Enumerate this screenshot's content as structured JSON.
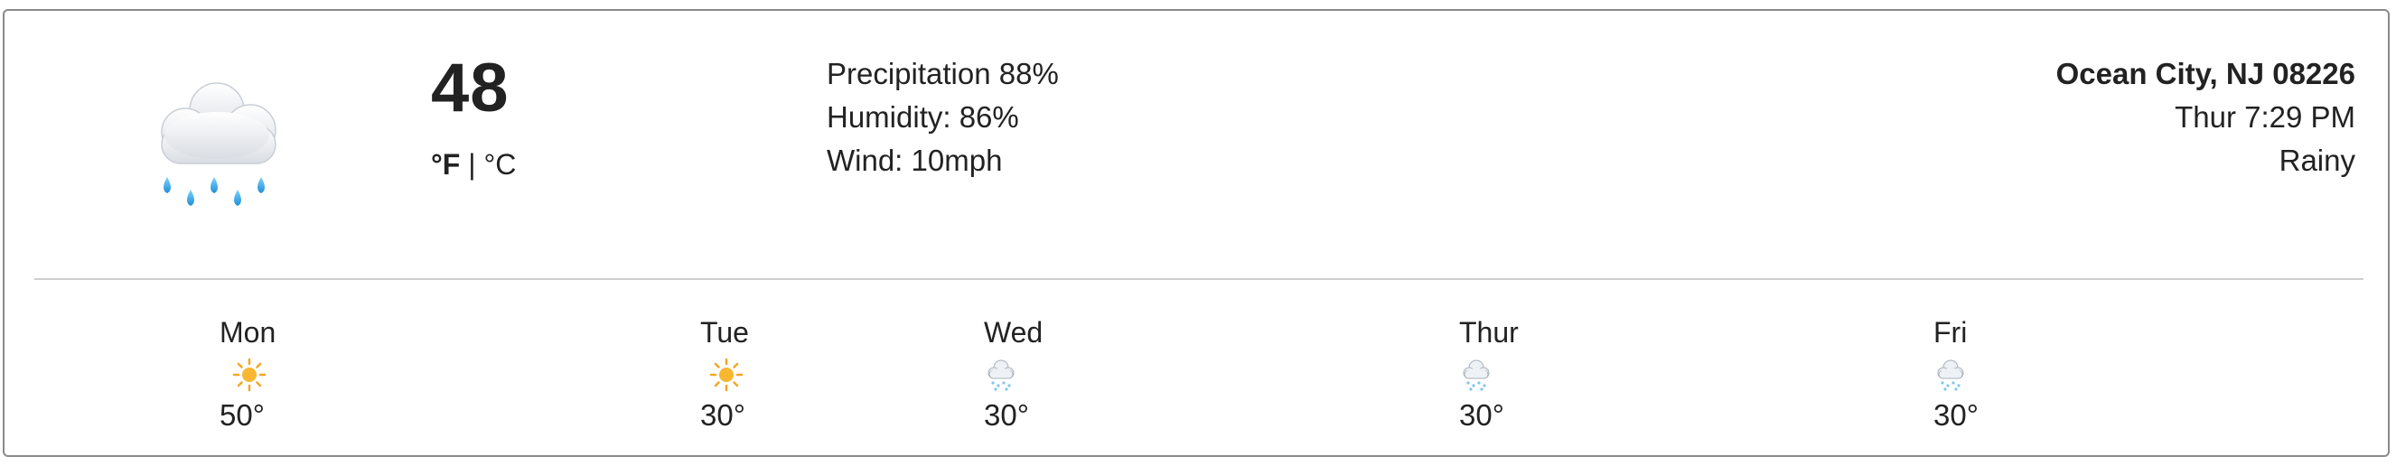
{
  "current": {
    "temperature": "48",
    "unit_f": "°F",
    "unit_separator": "|",
    "unit_c": "°C",
    "icon": "rain-cloud-icon",
    "precipitation": "Precipitation 88%",
    "humidity": "Humidity: 86%",
    "wind": "Wind: 10mph"
  },
  "location": {
    "city": "Ocean City, NJ 08226",
    "datetime": "Thur 7:29 PM",
    "condition": "Rainy"
  },
  "forecast": [
    {
      "day": "Mon",
      "icon": "sun-icon",
      "temp": "50°"
    },
    {
      "day": "Tue",
      "icon": "sun-icon",
      "temp": "30°"
    },
    {
      "day": "Wed",
      "icon": "snow-cloud-icon",
      "temp": "30°"
    },
    {
      "day": "Thur",
      "icon": "snow-cloud-icon",
      "temp": "30°"
    },
    {
      "day": "Fri",
      "icon": "snow-cloud-icon",
      "temp": "30°"
    }
  ],
  "colors": {
    "border": "#8a8a8a",
    "divider": "#cfcfcf",
    "rain_drop": "#29a3e6",
    "sun": "#f5a623"
  }
}
